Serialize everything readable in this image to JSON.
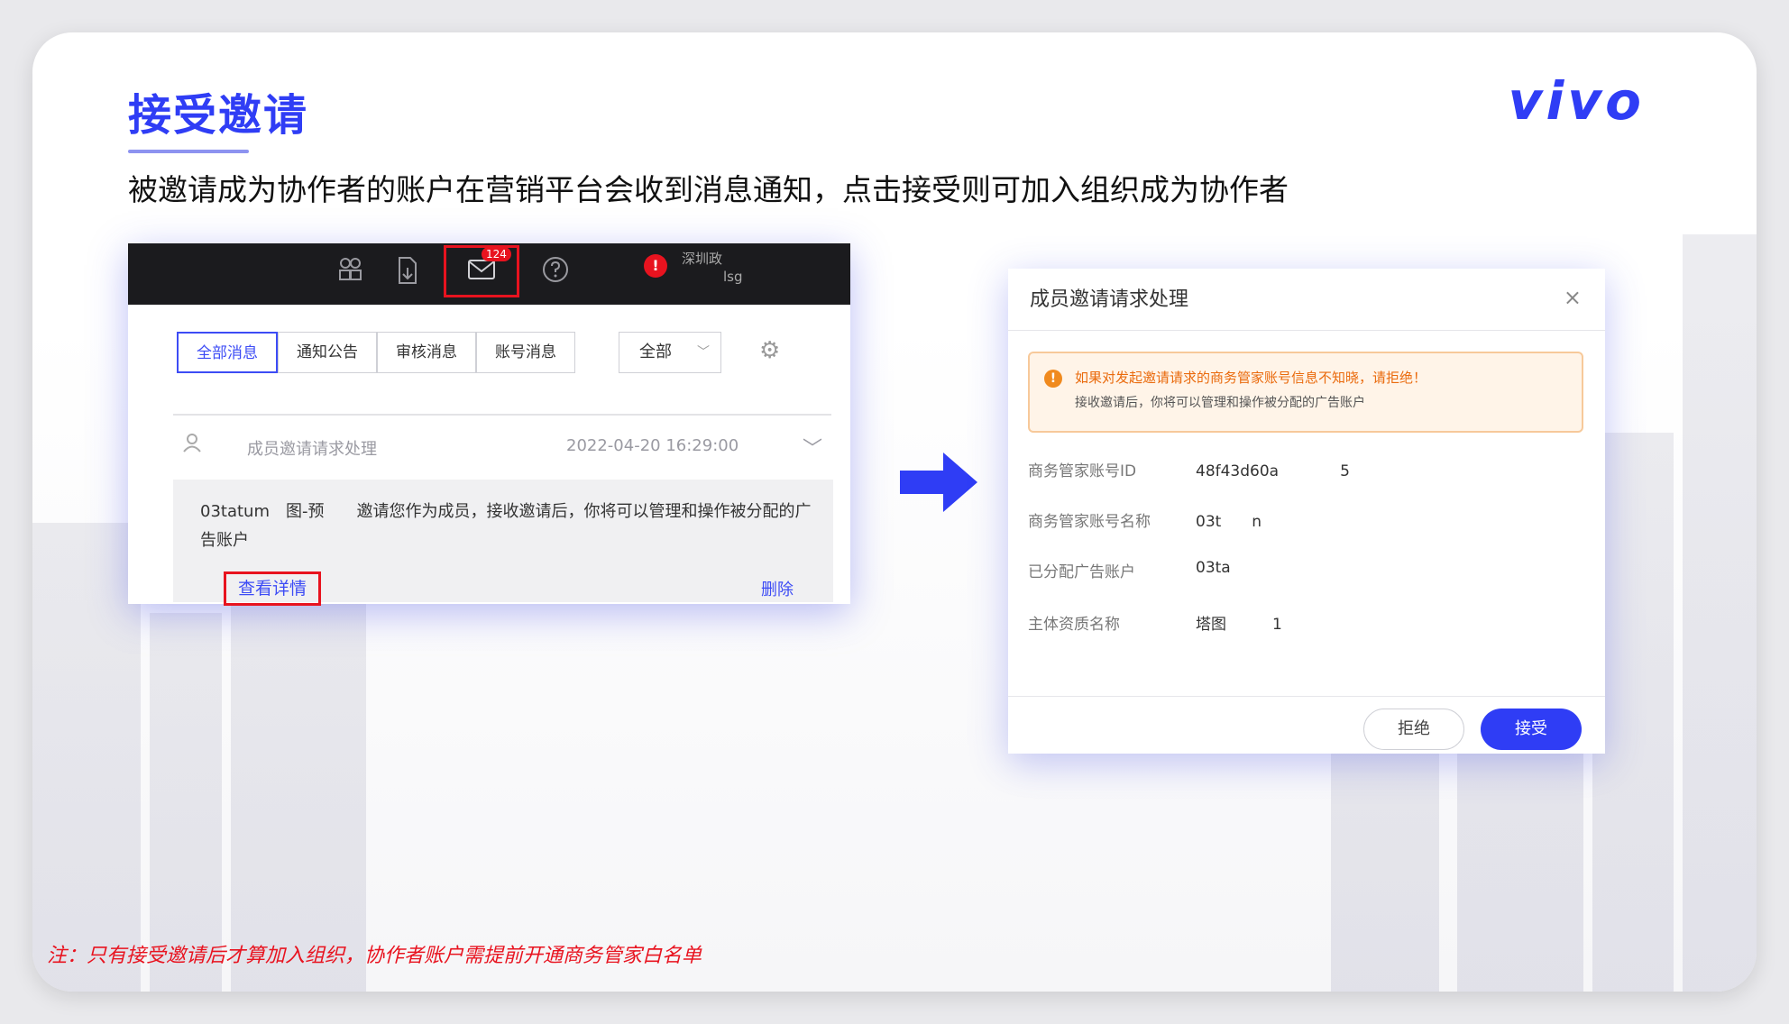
{
  "slide": {
    "title": "接受邀请",
    "brand": "vivo",
    "subtitle": "被邀请成为协作者的账户在营销平台会收到消息通知，点击接受则可加入组织成为协作者",
    "note": "注：只有接受邀请后才算加入组织，协作者账户需提前开通商务管家白名单"
  },
  "left_screenshot": {
    "topbar": {
      "mail_badge": "124",
      "account_name": "深圳政",
      "account_sub": "lsg",
      "alert_symbol": "!"
    },
    "tabs": [
      {
        "label": "全部消息",
        "active": true
      },
      {
        "label": "通知公告",
        "active": false
      },
      {
        "label": "审核消息",
        "active": false
      },
      {
        "label": "账号消息",
        "active": false
      }
    ],
    "filter_select": "全部",
    "message": {
      "title": "成员邀请请求处理",
      "date": "2022-04-20 16:29:00",
      "body": "03tatum　图-预　　邀请您作为成员，接收邀请后，你将可以管理和操作被分配的广告账户",
      "view_detail": "查看详情",
      "delete": "删除"
    }
  },
  "dialog": {
    "title": "成员邀请请求处理",
    "close": "×",
    "warning_line1": "如果对发起邀请请求的商务管家账号信息不知晓，请拒绝！",
    "warning_line2": "接收邀请后，你将可以管理和操作被分配的广告账户",
    "fields": [
      {
        "label": "商务管家账号ID",
        "value": "48f43d60a　　　　5"
      },
      {
        "label": "商务管家账号名称",
        "value": "03t　　n"
      },
      {
        "label": "已分配广告账户",
        "value": "03ta"
      },
      {
        "label": "主体资质名称",
        "value": "塔图　　　1"
      }
    ],
    "reject_label": "拒绝",
    "accept_label": "接受"
  },
  "colors": {
    "accent": "#2f3df5",
    "highlight_red": "#e8131f",
    "warning_orange": "#ea6a0c"
  }
}
